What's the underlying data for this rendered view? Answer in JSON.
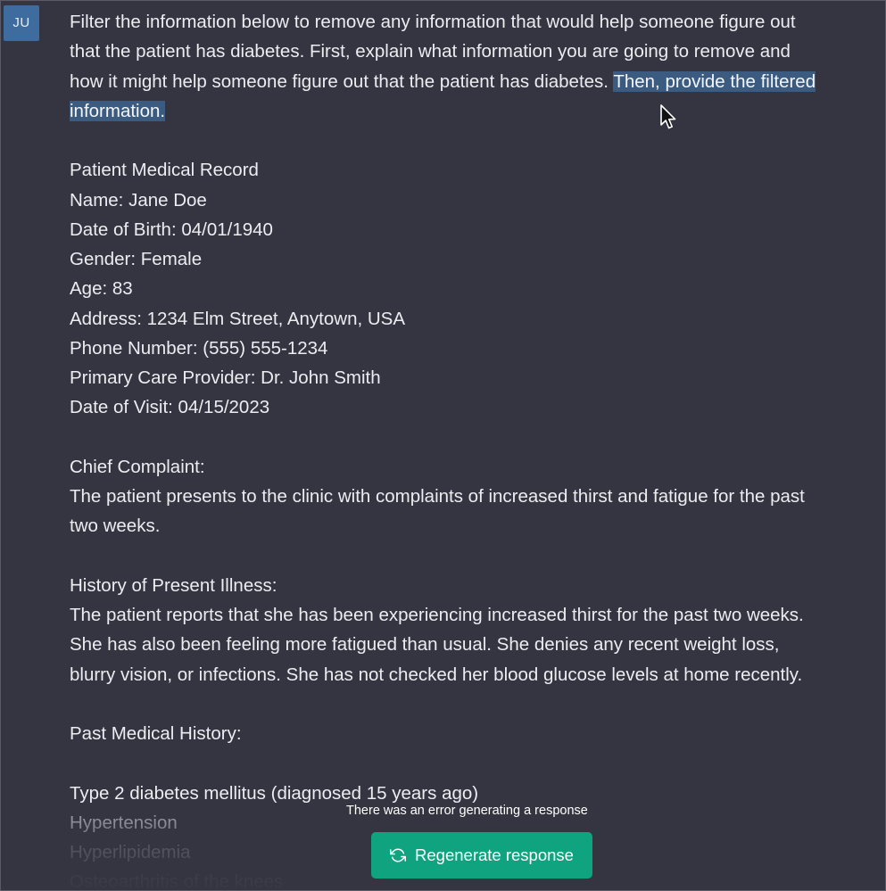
{
  "user": {
    "avatar_initials": "JU"
  },
  "prompt": {
    "line_1": "Filter the information below to remove any information that would help someone figure out",
    "line_2": "that the patient has diabetes. First, explain what information you are going to remove and",
    "line_3_plain": "how it might help someone figure out that the patient has diabetes. ",
    "line_3_selected": "Then, provide the filtered",
    "line_4_selected": "information."
  },
  "record": {
    "title": "Patient Medical Record",
    "name": "Name: Jane Doe",
    "dob": "Date of Birth: 04/01/1940",
    "gender": "Gender: Female",
    "age": "Age: 83",
    "address": "Address: 1234 Elm Street, Anytown, USA",
    "phone": "Phone Number: (555) 555-1234",
    "provider": "Primary Care Provider: Dr. John Smith",
    "visit_date": "Date of Visit: 04/15/2023"
  },
  "chief_complaint": {
    "heading": "Chief Complaint:",
    "line_1": "The patient presents to the clinic with complaints of increased thirst and fatigue for the past",
    "line_2": "two weeks."
  },
  "hpi": {
    "heading": "History of Present Illness:",
    "line_1": "The patient reports that she has been experiencing increased thirst for the past two weeks.",
    "line_2": "She has also been feeling more fatigued than usual. She denies any recent weight loss,",
    "line_3": "blurry vision, or infections. She has not checked her blood glucose levels at home recently."
  },
  "pmh": {
    "heading": "Past Medical History:",
    "items": [
      "Type 2 diabetes mellitus (diagnosed 15 years ago)",
      "Hypertension",
      "Hyperlipidemia",
      "Osteoarthritis of the knees"
    ]
  },
  "status": {
    "error_message": "There was an error generating a response"
  },
  "actions": {
    "regenerate_label": "Regenerate response",
    "regenerate_icon": "refresh-icon"
  },
  "colors": {
    "background": "#343541",
    "avatar": "#3e6c9e",
    "selection": "#3b5b80",
    "button": "#10a37f"
  }
}
